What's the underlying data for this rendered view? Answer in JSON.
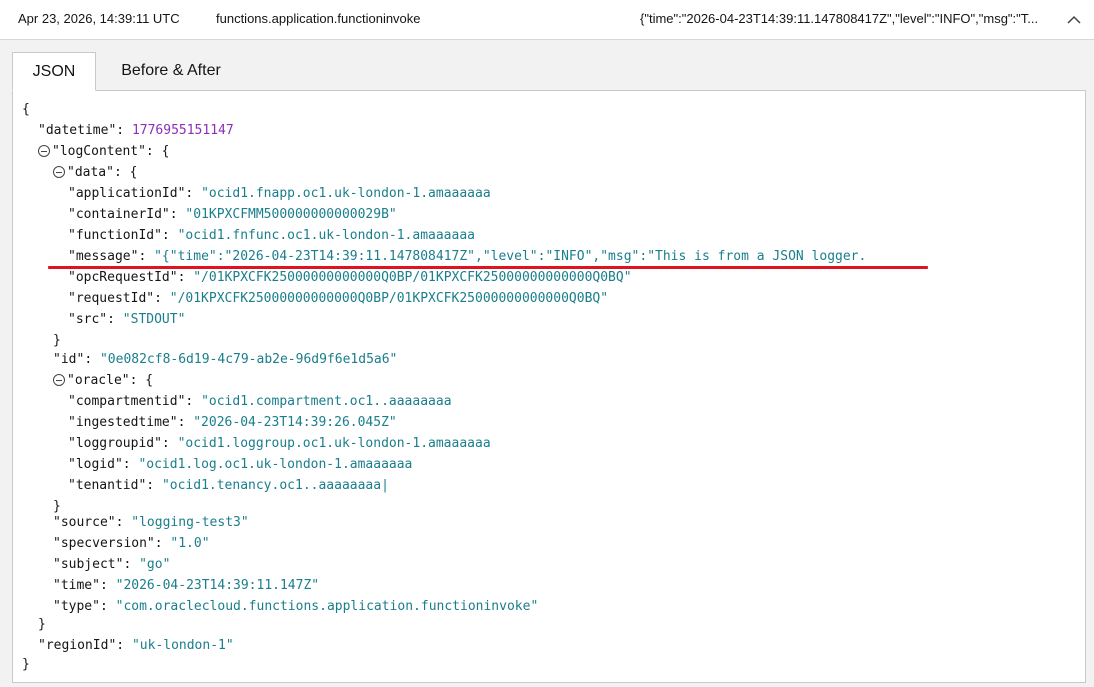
{
  "log_row": {
    "timestamp": "Apr 23, 2026, 14:39:11 UTC",
    "type": "functions.application.functioninvoke",
    "message_preview": "{\"time\":\"2026-04-23T14:39:11.147808417Z\",\"level\":\"INFO\",\"msg\":\"T..."
  },
  "tabs": [
    {
      "label": "JSON",
      "active": true
    },
    {
      "label": "Before & After",
      "active": false
    }
  ],
  "json": {
    "open_brace": "{",
    "close_brace": "}",
    "datetime_key": "\"datetime\"",
    "datetime_val": "1776955151147",
    "logContent_key": "\"logContent\"",
    "data_key": "\"data\"",
    "applicationId_key": "\"applicationId\"",
    "applicationId_val": "\"ocid1.fnapp.oc1.uk-london-1.amaaaaaa",
    "containerId_key": "\"containerId\"",
    "containerId_val": "\"01KPXCFMM500000000000029B\"",
    "functionId_key": "\"functionId\"",
    "functionId_val": "\"ocid1.fnfunc.oc1.uk-london-1.amaaaaaa",
    "message_key": "\"message\"",
    "message_val": "\"{\"time\":\"2026-04-23T14:39:11.147808417Z\",\"level\":\"INFO\",\"msg\":\"This is from a JSON logger.",
    "opcRequestId_key": "\"opcRequestId\"",
    "opcRequestId_val": "\"/01KPXCFK25000000000000Q0BP/01KPXCFK25000000000000Q0BQ\"",
    "requestId_key": "\"requestId\"",
    "requestId_val": "\"/01KPXCFK25000000000000Q0BP/01KPXCFK25000000000000Q0BQ\"",
    "src_key": "\"src\"",
    "src_val": "\"STDOUT\"",
    "id_key": "\"id\"",
    "id_val": "\"0e082cf8-6d19-4c79-ab2e-96d9f6e1d5a6\"",
    "oracle_key": "\"oracle\"",
    "compartmentid_key": "\"compartmentid\"",
    "compartmentid_val": "\"ocid1.compartment.oc1..aaaaaaaa",
    "ingestedtime_key": "\"ingestedtime\"",
    "ingestedtime_val": "\"2026-04-23T14:39:26.045Z\"",
    "loggroupid_key": "\"loggroupid\"",
    "loggroupid_val": "\"ocid1.loggroup.oc1.uk-london-1.amaaaaaa",
    "logid_key": "\"logid\"",
    "logid_val": "\"ocid1.log.oc1.uk-london-1.amaaaaaa",
    "tenantid_key": "\"tenantid\"",
    "tenantid_val": "\"ocid1.tenancy.oc1..aaaaaaaa|",
    "source_key": "\"source\"",
    "source_val": "\"logging-test3\"",
    "specversion_key": "\"specversion\"",
    "specversion_val": "\"1.0\"",
    "subject_key": "\"subject\"",
    "subject_val": "\"go\"",
    "time_key": "\"time\"",
    "time_val": "\"2026-04-23T14:39:11.147Z\"",
    "type_key": "\"type\"",
    "type_val": "\"com.oraclecloud.functions.application.functioninvoke\"",
    "regionId_key": "\"regionId\"",
    "regionId_val": "\"uk-london-1\""
  },
  "colors": {
    "json_string": "#1a7e8c",
    "json_number": "#8a2fb8",
    "highlight_underline": "#e0141e"
  }
}
